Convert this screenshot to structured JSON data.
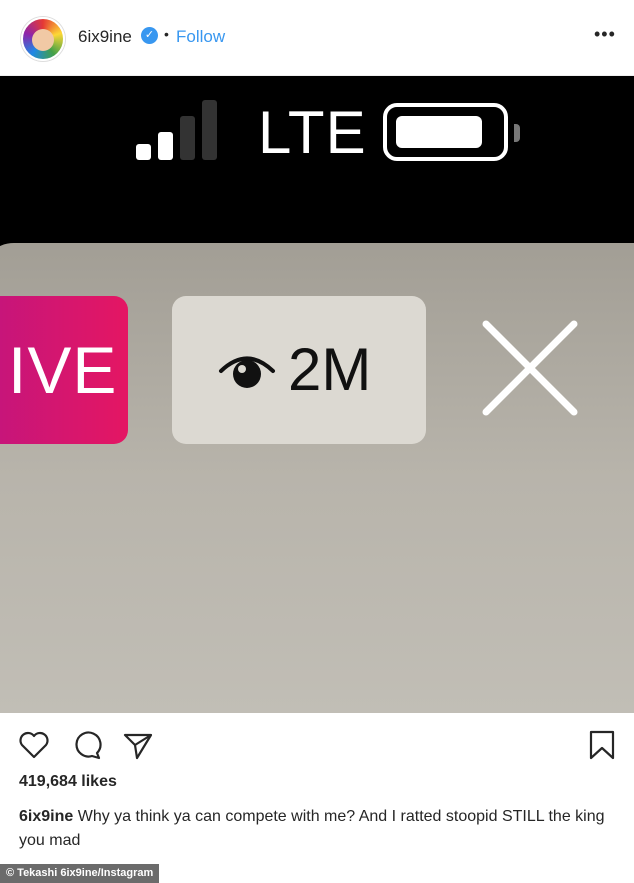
{
  "header": {
    "username": "6ix9ine",
    "verified_mark": "✓",
    "separator": "•",
    "follow_label": "Follow",
    "more_label": "•••"
  },
  "media": {
    "status_bar": {
      "network": "LTE",
      "signal_bars": 2,
      "signal_bars_total": 4
    },
    "live_badge": "IVE",
    "viewer_count": "2M",
    "icons": [
      "eye-icon",
      "close-icon",
      "battery-icon",
      "signal-icon"
    ]
  },
  "actions": {
    "icons": [
      "heart-icon",
      "comment-icon",
      "share-icon",
      "bookmark-icon"
    ]
  },
  "likes": "419,684 likes",
  "caption": {
    "username": "6ix9ine",
    "text": "Why ya think ya can compete with me? And I ratted stoopid STILL the king you mad"
  },
  "credit": "© Tekashi 6ix9ine/Instagram",
  "colors": {
    "follow": "#3897f0",
    "live_gradient_start": "#c0157f",
    "live_gradient_end": "#e41663",
    "panel": "#b8b4ab"
  }
}
